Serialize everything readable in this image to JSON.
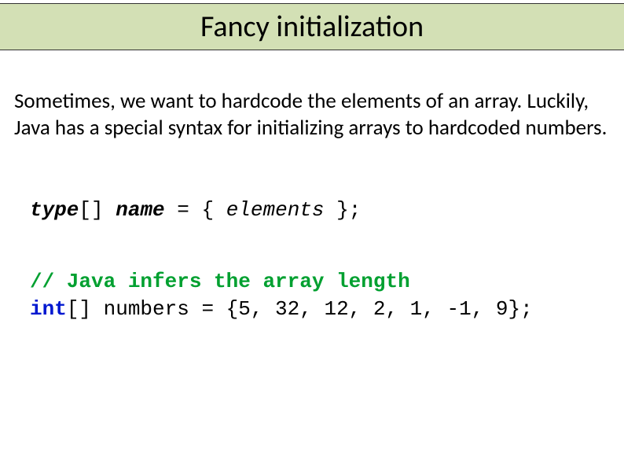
{
  "title": "Fancy initialization",
  "paragraph": "Sometimes, we want to hardcode the elements of an array. Luckily, Java has a special syntax for initializing arrays to hardcoded numbers.",
  "syntax": {
    "type": "type",
    "brackets": "[]",
    "name": "name",
    "equals": " = { ",
    "elements": "elements",
    "closing": " };"
  },
  "example": {
    "comment": "// Java infers the array length",
    "keyword": "int",
    "rest": "[] numbers = {5, 32, 12, 2, 1, -1, 9};"
  }
}
